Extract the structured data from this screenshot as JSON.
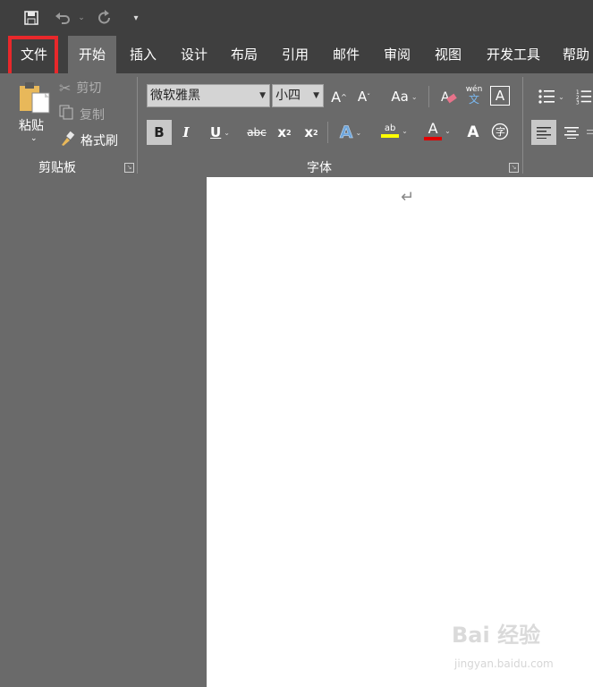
{
  "quick_access": {
    "save_icon": "save-icon",
    "undo_icon": "undo-icon",
    "redo_icon": "redo-icon",
    "customize_icon": "customize-qat-icon"
  },
  "tabs": [
    {
      "label": "文件"
    },
    {
      "label": "开始"
    },
    {
      "label": "插入"
    },
    {
      "label": "设计"
    },
    {
      "label": "布局"
    },
    {
      "label": "引用"
    },
    {
      "label": "邮件"
    },
    {
      "label": "审阅"
    },
    {
      "label": "视图"
    },
    {
      "label": "开发工具"
    },
    {
      "label": "帮助"
    }
  ],
  "clipboard": {
    "paste_label": "粘贴",
    "cut_label": "剪切",
    "copy_label": "复制",
    "format_painter_label": "格式刷",
    "group_label": "剪贴板"
  },
  "font": {
    "font_name": "微软雅黑",
    "font_size": "小四",
    "change_case_label": "Aa",
    "bold_label": "B",
    "italic_label": "I",
    "underline_label": "U",
    "strikethrough_label": "abc",
    "subscript_label": "x",
    "superscript_label": "x",
    "wen_pinyin": "wén",
    "wen_char": "文",
    "group_label": "字体",
    "highlight_color": "#ffff00",
    "font_color": "#e00000"
  },
  "document": {
    "paragraph_mark": "↵"
  },
  "watermark": {
    "main": "Bai 经验",
    "sub": "jingyan.baidu.com"
  }
}
